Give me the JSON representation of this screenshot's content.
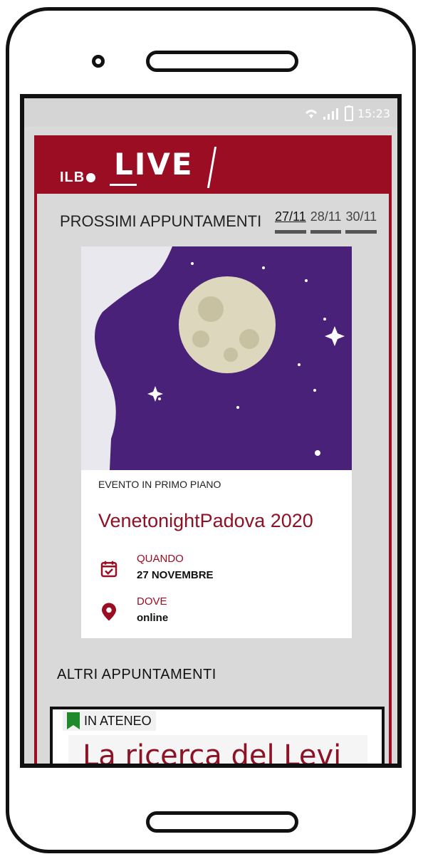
{
  "status_bar": {
    "time": "15:23",
    "icons": [
      "wifi-icon",
      "signal-icon",
      "battery-icon"
    ]
  },
  "brand": {
    "prefix": "ILB",
    "name": "LIVE"
  },
  "upcoming": {
    "title": "PROSSIMI APPUNTAMENTI",
    "dates": [
      {
        "label": "27/11",
        "active": true
      },
      {
        "label": "28/11",
        "active": false
      },
      {
        "label": "30/11",
        "active": false
      }
    ]
  },
  "featured_event": {
    "kicker": "EVENTO IN PRIMO PIANO",
    "title": "VenetonightPadova 2020",
    "when_label": "QUANDO",
    "when_value": "27 NOVEMBRE",
    "where_label": "DOVE",
    "where_value": "online"
  },
  "other_events": {
    "title": "ALTRI APPUNTAMENTI",
    "cards": [
      {
        "tag": "IN ATENEO",
        "headline": "La ricerca del Levi Cases:"
      }
    ]
  },
  "colors": {
    "brand_red": "#9b0d23",
    "background": "#d9d9d9",
    "tag_green": "#1f8a2b",
    "night_purple": "#4a2178"
  }
}
